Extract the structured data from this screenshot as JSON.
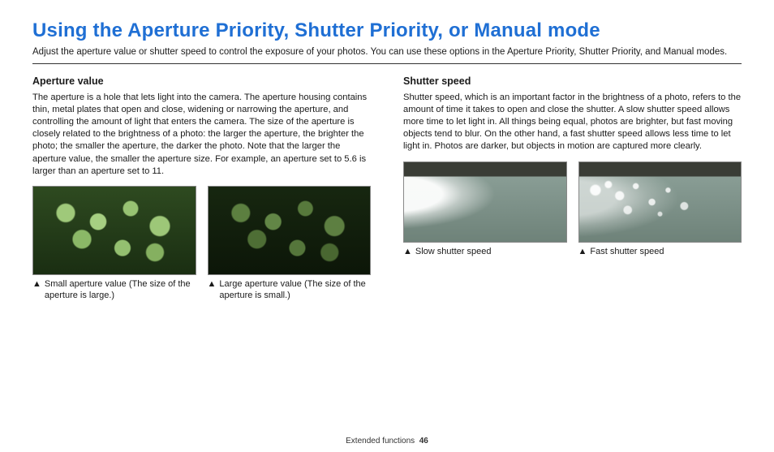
{
  "title": "Using the Aperture Priority, Shutter Priority, or Manual mode",
  "intro": "Adjust the aperture value or shutter speed to control the exposure of your photos. You can use these options in the Aperture Priority, Shutter Priority, and Manual modes.",
  "left": {
    "heading": "Aperture value",
    "body": "The aperture is a hole that lets light into the camera. The aperture housing contains thin, metal plates that open and close, widening or narrowing the aperture, and controlling the amount of light that enters the camera. The size of the aperture is closely related to the brightness of a photo: the larger the aperture, the brighter the photo; the smaller the aperture, the darker the photo. Note that the larger the aperture value, the smaller the aperture size. For example, an aperture set to 5.6 is larger than an aperture set to 11.",
    "captions": [
      "Small aperture value (The size of the aperture is large.)",
      "Large aperture value (The size of the aperture is small.)"
    ]
  },
  "right": {
    "heading": "Shutter speed",
    "body": "Shutter speed, which is an important factor in the brightness of a photo, refers to the amount of time it takes to open and close the shutter. A slow shutter speed allows more time to let light in. All things being equal, photos are brighter, but fast moving objects tend to blur. On the other hand, a fast shutter speed allows less time to let light in. Photos are darker, but objects in motion are captured more clearly.",
    "captions": [
      "Slow shutter speed",
      "Fast shutter speed"
    ]
  },
  "footer": {
    "section": "Extended functions",
    "page": "46"
  },
  "triangle": "▲"
}
